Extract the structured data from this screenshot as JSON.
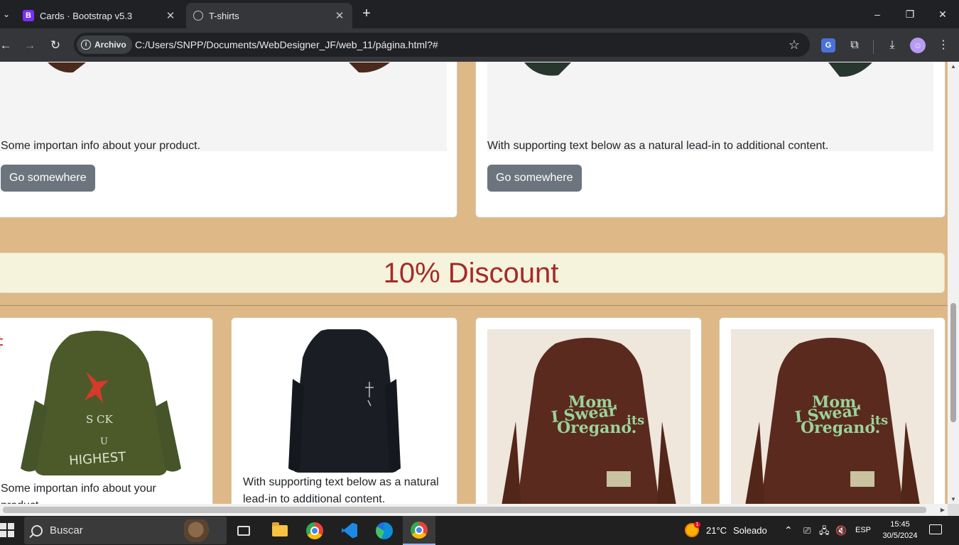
{
  "browser": {
    "tabs": [
      {
        "title": "Cards · Bootstrap v5.3",
        "favicon": "B",
        "active": false
      },
      {
        "title": "T-shirts",
        "favicon": "globe-icon",
        "active": true
      }
    ],
    "new_tab": "+",
    "window": {
      "minimize": "–",
      "maximize": "❐",
      "close": "✕"
    },
    "nav": {
      "back": "←",
      "forward": "→",
      "reload": "↻"
    },
    "security_chip": "Archivo",
    "url": "C:/Users/SNPP/Documents/WebDesigner_JF/web_11/página.html?#",
    "toolbar_icons": [
      "star-icon",
      "translate-icon",
      "extensions-icon",
      "download-icon",
      "profile-avatar",
      "menu-icon"
    ]
  },
  "page": {
    "top_cards": [
      {
        "text": "Some importan info about your product.",
        "button": "Go somewhere"
      },
      {
        "text": "With supporting text below as a natural lead-in to additional content.",
        "button": "Go somewhere"
      }
    ],
    "discount_heading": "10% Discount",
    "products": [
      {
        "text": "Some importan info about your product.",
        "image": "green-hoodie",
        "image_text": [
          "S CK",
          "U",
          "HIGHEST"
        ]
      },
      {
        "text": "With supporting text below as a natural lead-in to additional content.",
        "image": "black-hoodie"
      },
      {
        "image": "brown-hoodie",
        "image_text": [
          "Mom,",
          "I Swear",
          "its",
          "Oregano."
        ]
      },
      {
        "image": "brown-hoodie",
        "image_text": [
          "Mom,",
          "I Swear",
          "its",
          "Oregano."
        ]
      }
    ]
  },
  "taskbar": {
    "search_placeholder": "Buscar",
    "weather": {
      "temp": "21°C",
      "condition": "Soleado",
      "badge": "1"
    },
    "language": "ESP",
    "time": "15:45",
    "date": "30/5/2024"
  }
}
